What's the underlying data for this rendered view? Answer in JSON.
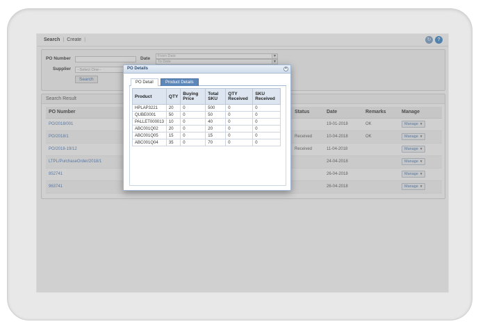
{
  "topbar": {
    "links": [
      "Search",
      "Create"
    ],
    "separator": "|"
  },
  "filter": {
    "po_number_label": "PO Number",
    "date_label": "Date",
    "from_date_placeholder": "From Date",
    "to_date_placeholder": "To Date",
    "supplier_label": "Supplier",
    "supplier_selected": "--Select One--",
    "search_button": "Search"
  },
  "result": {
    "header": "Search Result",
    "columns": [
      "PO Number",
      "",
      "",
      "Status",
      "Date",
      "Remarks",
      "Manage"
    ],
    "rows": [
      {
        "po": "PO/2018/001",
        "status": "",
        "date": "19-01-2018",
        "remarks": "OK",
        "manage": "Manage"
      },
      {
        "po": "PO/2018/1",
        "status": "Received",
        "date": "10-04-2018",
        "remarks": "OK",
        "manage": "Manage"
      },
      {
        "po": "PO/2018-19/12",
        "status": "Received",
        "date": "11-04-2018",
        "remarks": "",
        "manage": "Manage"
      },
      {
        "po": "LTPL/PurchaseOrder/2018/1",
        "status": "",
        "date": "24-04-2018",
        "remarks": "",
        "manage": "Manage"
      },
      {
        "po": "852741",
        "status": "",
        "date": "26-04-2018",
        "remarks": "",
        "manage": "Manage"
      },
      {
        "po": "963741",
        "status": "",
        "date": "26-04-2018",
        "remarks": "",
        "manage": "Manage"
      }
    ]
  },
  "modal": {
    "title": "PO Details",
    "close_glyph": "×",
    "tabs": [
      "PO Detail",
      "Product Details"
    ],
    "table": {
      "headers": [
        "Product",
        "QTY",
        "Buying Price",
        "Total SKU",
        "QTY Received",
        "SKU Received"
      ],
      "rows": [
        [
          "HPLAP3221",
          "20",
          "0",
          "500",
          "0",
          "0"
        ],
        [
          "QUBE0001",
          "50",
          "0",
          "50",
          "0",
          "0"
        ],
        [
          "PALLET000013",
          "10",
          "0",
          "40",
          "0",
          "0"
        ],
        [
          "ABC001Q02",
          "20",
          "0",
          "20",
          "0",
          "0"
        ],
        [
          "ABC001Q05",
          "15",
          "0",
          "15",
          "0",
          "0"
        ],
        [
          "ABC001Q04",
          "35",
          "0",
          "70",
          "0",
          "0"
        ]
      ]
    }
  },
  "icons": {
    "refresh": "refresh-icon",
    "help": "help-icon",
    "dropdown": "chevron-down-icon"
  }
}
